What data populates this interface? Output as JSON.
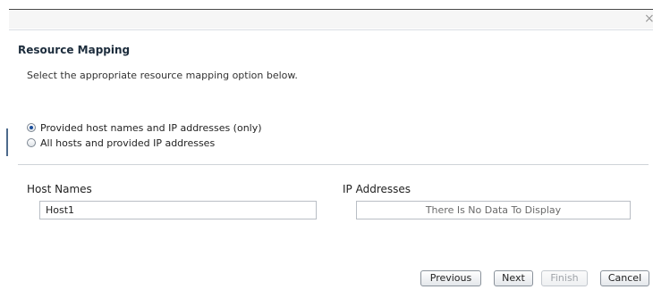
{
  "window": {
    "close_glyph": "×"
  },
  "resource_mapping": {
    "title": "Resource Mapping",
    "description": "Select the appropriate resource mapping option below.",
    "options": [
      {
        "label": "Provided host names and IP addresses (only)",
        "selected": true
      },
      {
        "label": "All hosts and provided IP addresses",
        "selected": false
      }
    ],
    "host_names": {
      "label": "Host Names",
      "value": "Host1"
    },
    "ip_addresses": {
      "label": "IP Addresses",
      "empty_text": "There Is No Data To Display"
    }
  },
  "footer": {
    "previous": "Previous",
    "next": "Next",
    "finish": "Finish",
    "cancel": "Cancel"
  }
}
